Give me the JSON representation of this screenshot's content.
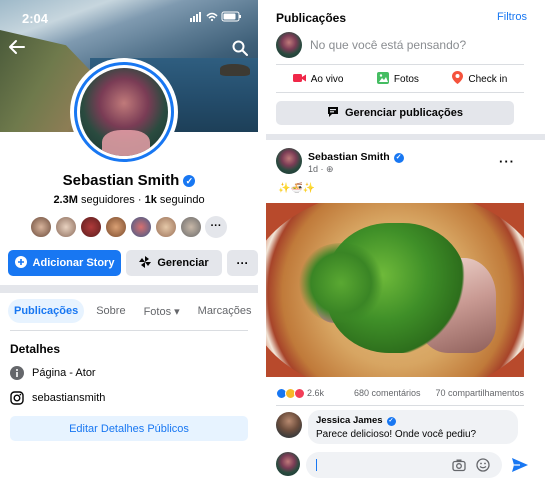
{
  "status_bar": {
    "time": "2:04",
    "icons": "▮▮▮ ◠ ▬"
  },
  "profile": {
    "name": "Sebastian Smith",
    "followers_count": "2.3M",
    "followers_label": "seguidores",
    "following_count": "1k",
    "following_label": "seguindo",
    "friends_more": "···"
  },
  "buttons": {
    "add_story": "Adicionar Story",
    "manage": "Gerenciar",
    "more": "···"
  },
  "tabs": [
    "Publicações",
    "Sobre",
    "Fotos ▾",
    "Marcações"
  ],
  "details": {
    "title": "Detalhes",
    "page_type": "Página - Ator",
    "instagram": "sebastiansmith",
    "edit_button": "Editar Detalhes Públicos"
  },
  "feed": {
    "header": "Publicações",
    "filters": "Filtros",
    "composer_placeholder": "No que você está pensando?",
    "actions": [
      "Ao vivo",
      "Fotos",
      "Check in"
    ],
    "manage_posts": "Gerenciar publicações"
  },
  "post": {
    "author": "Sebastian Smith",
    "time": "1d · ⊕",
    "emojis": "✨🍜✨",
    "reaction_count": "2.6k",
    "comments": "680 comentários",
    "shares": "70 compartilhamentos"
  },
  "comment": {
    "author": "Jessica James",
    "text": "Parece delicioso! Onde você pediu?"
  },
  "colors": {
    "brand_blue": "#1877f2",
    "button_grey": "#e4e6eb",
    "light_blue": "#e7f3ff",
    "live_red": "#f02849",
    "photo_green": "#45bd62",
    "checkin_red": "#f5533d"
  }
}
